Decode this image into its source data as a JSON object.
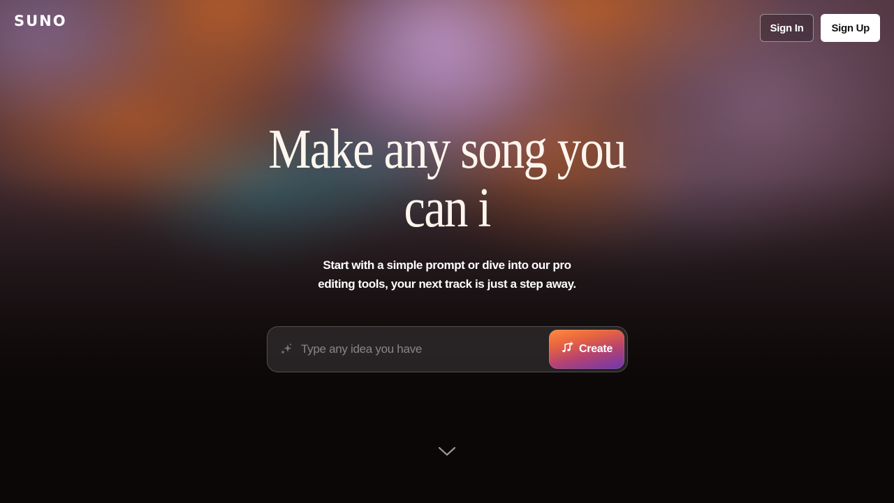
{
  "header": {
    "logo_text": "SUNO",
    "sign_in_label": "Sign In",
    "sign_up_label": "Sign Up"
  },
  "hero": {
    "title_line1": "Make any song you",
    "title_line2": "can i",
    "subtitle_line1": "Start with a simple prompt or dive into our pro",
    "subtitle_line2": "editing tools, your next track is just a step away."
  },
  "prompt": {
    "placeholder": "Type any idea you have",
    "value": "",
    "leading_icon": "sparkle-icon",
    "create_label": "Create",
    "create_icon": "music-note-plus-icon"
  },
  "scroll_hint": {
    "icon": "chevron-down-icon"
  },
  "colors": {
    "title": "#fdf6ee",
    "create_gradient_start": "#ff8a3d",
    "create_gradient_end": "#6e36b2",
    "page_background": "#0b0707"
  }
}
